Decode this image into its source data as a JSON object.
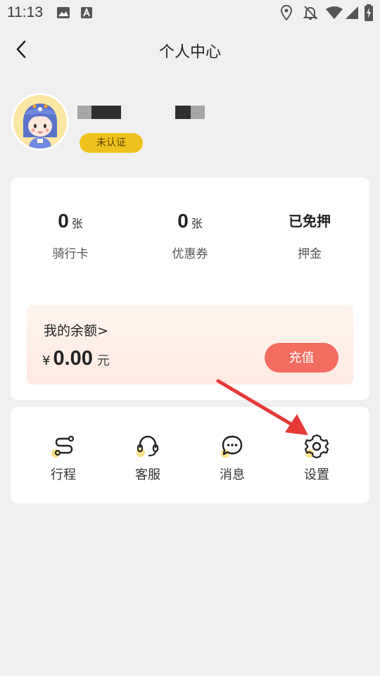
{
  "status_bar": {
    "time": "11:13",
    "icons": [
      "image-icon",
      "text-a-icon",
      "location-icon",
      "bell-off-icon",
      "wifi-icon",
      "signal-icon",
      "battery-charging-icon"
    ]
  },
  "nav": {
    "back_icon": "chevron-left-icon",
    "title": "个人中心"
  },
  "profile": {
    "avatar": "avatar-cartoon",
    "badge": "未认证"
  },
  "stats": [
    {
      "value": "0",
      "unit": "张",
      "label": "骑行卡"
    },
    {
      "value": "0",
      "unit": "张",
      "label": "优惠券"
    },
    {
      "value": "已免押",
      "unit": "",
      "label": "押金"
    }
  ],
  "balance": {
    "title": "我的余额>",
    "currency": "¥",
    "amount": "0.00",
    "unit": "元",
    "recharge_label": "充值"
  },
  "menu": [
    {
      "label": "行程",
      "icon": "route-icon"
    },
    {
      "label": "客服",
      "icon": "headset-icon"
    },
    {
      "label": "消息",
      "icon": "chat-icon"
    },
    {
      "label": "设置",
      "icon": "gear-icon"
    }
  ],
  "colors": {
    "accent_yellow": "#eec21d",
    "recharge_red": "#f26c60",
    "annotation_arrow": "#e53935",
    "background": "#f0f0f1"
  }
}
